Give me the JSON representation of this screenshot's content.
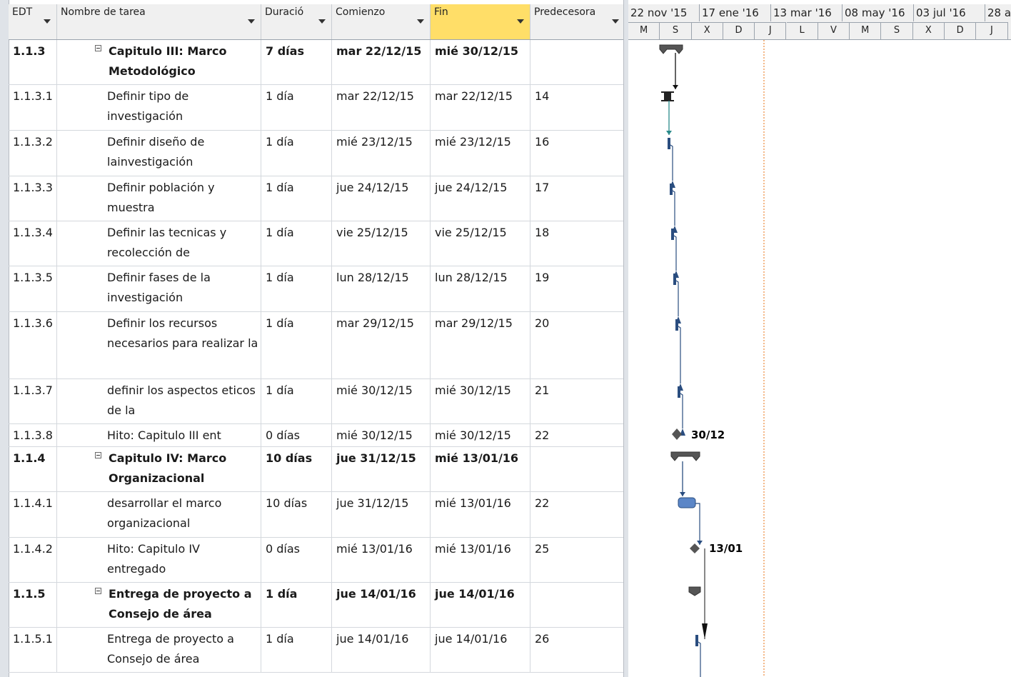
{
  "columns": [
    "EDT",
    "Nombre de tarea",
    "Duració",
    "Comienzo",
    "Fin",
    "Predecesora"
  ],
  "rows": [
    {
      "edt": "1.1.3",
      "name": "Capitulo III: Marco Metodológico",
      "dur": "7 días",
      "start": "mar 22/12/15",
      "end": "mié 30/12/15",
      "pred": "",
      "summary": true
    },
    {
      "edt": "1.1.3.1",
      "name": "Definir tipo de investigación",
      "dur": "1 día",
      "start": "mar 22/12/15",
      "end": "mar 22/12/15",
      "pred": "14",
      "summary": false
    },
    {
      "edt": "1.1.3.2",
      "name": "Definir diseño de lainvestigación",
      "dur": "1 día",
      "start": "mié 23/12/15",
      "end": "mié 23/12/15",
      "pred": "16",
      "summary": false
    },
    {
      "edt": "1.1.3.3",
      "name": "Definir población y muestra",
      "dur": "1 día",
      "start": "jue 24/12/15",
      "end": "jue 24/12/15",
      "pred": "17",
      "summary": false
    },
    {
      "edt": "1.1.3.4",
      "name": "Definir las tecnicas y recolección de",
      "dur": "1 día",
      "start": "vie 25/12/15",
      "end": "vie 25/12/15",
      "pred": "18",
      "summary": false
    },
    {
      "edt": "1.1.3.5",
      "name": "Definir fases de la investigación",
      "dur": "1 día",
      "start": "lun 28/12/15",
      "end": "lun 28/12/15",
      "pred": "19",
      "summary": false
    },
    {
      "edt": "1.1.3.6",
      "name": "Definir los recursos necesarios para realizar la",
      "dur": "1 día",
      "start": "mar 29/12/15",
      "end": "mar 29/12/15",
      "pred": "20",
      "summary": false
    },
    {
      "edt": "1.1.3.7",
      "name": "definir los aspectos eticos de la",
      "dur": "1 día",
      "start": "mié 30/12/15",
      "end": "mié 30/12/15",
      "pred": "21",
      "summary": false
    },
    {
      "edt": "1.1.3.8",
      "name": "Hito: Capitulo III ent",
      "dur": "0 días",
      "start": "mié 30/12/15",
      "end": "mié 30/12/15",
      "pred": "22",
      "summary": false
    },
    {
      "edt": "1.1.4",
      "name": "Capitulo IV: Marco Organizacional",
      "dur": "10 días",
      "start": "jue 31/12/15",
      "end": "mié 13/01/16",
      "pred": "",
      "summary": true
    },
    {
      "edt": "1.1.4.1",
      "name": "desarrollar el marco organizacional",
      "dur": "10 días",
      "start": "jue 31/12/15",
      "end": "mié 13/01/16",
      "pred": "22",
      "summary": false
    },
    {
      "edt": "1.1.4.2",
      "name": "Hito: Capitulo IV entregado",
      "dur": "0 días",
      "start": "mié 13/01/16",
      "end": "mié 13/01/16",
      "pred": "25",
      "summary": false
    },
    {
      "edt": "1.1.5",
      "name": "Entrega de proyecto a Consejo de área",
      "dur": "1 día",
      "start": "jue 14/01/16",
      "end": "jue 14/01/16",
      "pred": "",
      "summary": true
    },
    {
      "edt": "1.1.5.1",
      "name": "Entrega de proyecto a Consejo de área",
      "dur": "1 día",
      "start": "jue 14/01/16",
      "end": "jue 14/01/16",
      "pred": "26",
      "summary": false
    }
  ],
  "timescale": {
    "top": [
      "22 nov '15",
      "17 ene '16",
      "13 mar '16",
      "08 may '16",
      "03 jul '16",
      "28 a"
    ],
    "bottom": [
      "M",
      "S",
      "X",
      "D",
      "J",
      "L",
      "V",
      "M",
      "S",
      "X",
      "D",
      "J"
    ]
  },
  "milestones": [
    "30/12",
    "13/01"
  ]
}
